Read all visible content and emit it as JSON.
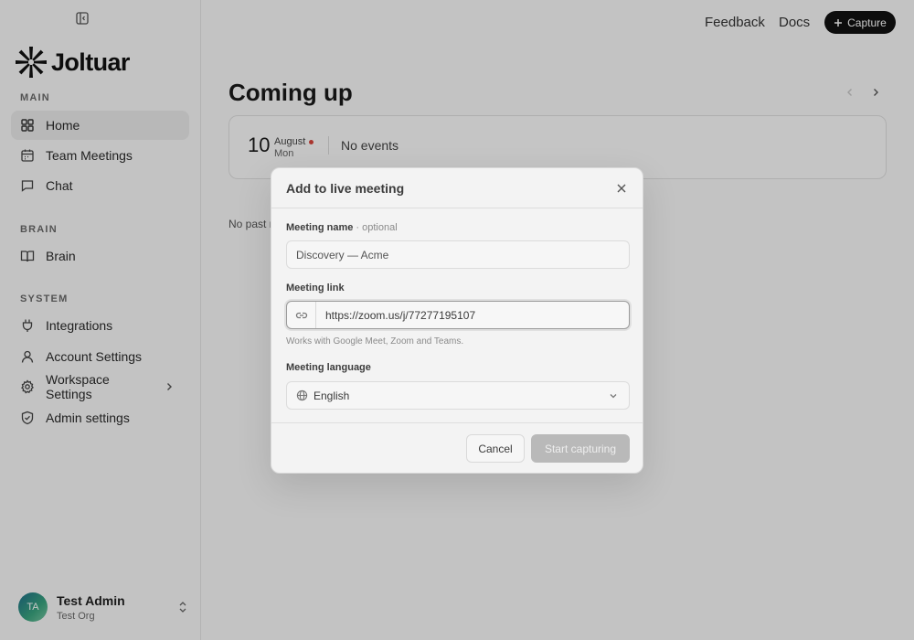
{
  "brand": {
    "name": "Joltuar"
  },
  "sidebar": {
    "sections": [
      {
        "label": "MAIN"
      },
      {
        "label": "BRAIN"
      },
      {
        "label": "SYSTEM"
      }
    ],
    "items": [
      {
        "label": "Home",
        "icon": "grid-icon",
        "active": true
      },
      {
        "label": "Team Meetings",
        "icon": "calendar-icon"
      },
      {
        "label": "Chat",
        "icon": "chat-icon"
      },
      {
        "label": "Brain",
        "icon": "book-icon"
      },
      {
        "label": "Integrations",
        "icon": "plug-icon"
      },
      {
        "label": "Account Settings",
        "icon": "user-icon"
      },
      {
        "label": "Workspace Settings",
        "icon": "gear-icon"
      },
      {
        "label": "Admin settings",
        "icon": "shield-icon"
      }
    ],
    "user": {
      "initials": "TA",
      "name": "Test Admin",
      "org": "Test Org"
    }
  },
  "header": {
    "feedback": "Feedback",
    "docs": "Docs",
    "capture": "Capture"
  },
  "main": {
    "title": "Coming up",
    "date": {
      "day": "10",
      "month": "August",
      "weekday": "Mon"
    },
    "no_events": "No events",
    "no_past": "No past meetings"
  },
  "modal": {
    "title": "Add to live meeting",
    "name_label": "Meeting name",
    "name_optional": " · optional",
    "name_placeholder": "Discovery — Acme",
    "link_label": "Meeting link",
    "link_value": "https://zoom.us/j/77277195107",
    "link_helper": "Works with Google Meet, Zoom and Teams.",
    "language_label": "Meeting language",
    "language_value": "English",
    "cancel": "Cancel",
    "start": "Start capturing"
  },
  "colors": {
    "accent_dark": "#111111",
    "alert_dot": "#d9453c",
    "disabled_button": "#b9b9b9"
  }
}
